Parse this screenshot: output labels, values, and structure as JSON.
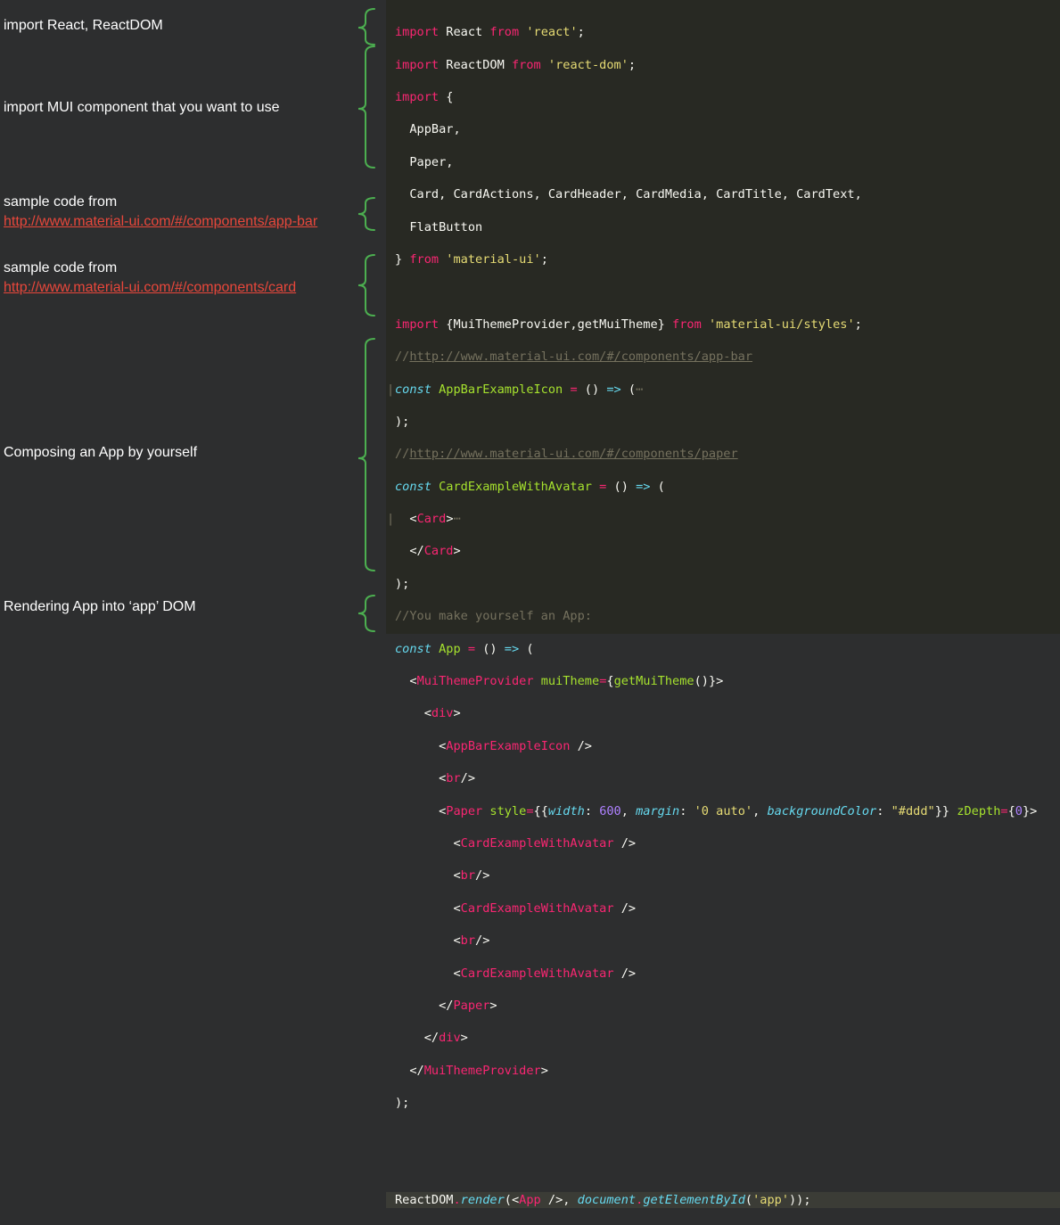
{
  "annotations": [
    {
      "id": "import-react",
      "text": "import React, ReactDOM",
      "link": ""
    },
    {
      "id": "import-mui",
      "text": "import MUI component that you want to use",
      "link": ""
    },
    {
      "id": "sample-appbar",
      "text": "sample code from",
      "link": "http://www.material-ui.com/#/components/app-bar"
    },
    {
      "id": "sample-card",
      "text": "sample code from",
      "link": "http://www.material-ui.com/#/components/card"
    },
    {
      "id": "compose-app",
      "text": "Composing an App by yourself",
      "link": ""
    },
    {
      "id": "render-app",
      "text": "Rendering App into ‘app’ DOM",
      "link": ""
    }
  ],
  "code": {
    "line1": [
      "import",
      " React ",
      "from",
      " 'react'",
      ";"
    ],
    "line2": [
      "import",
      " ReactDOM ",
      "from",
      " 'react-dom'",
      ";"
    ],
    "line3": [
      "import",
      " {"
    ],
    "line4": "  AppBar,",
    "line5": "  Paper,",
    "line6": "  Card, CardActions, CardHeader, CardMedia, CardTitle, CardText,",
    "line7": "  FlatButton",
    "line8": [
      "} ",
      "from",
      " 'material-ui'",
      ";"
    ],
    "line10": [
      "import",
      " {MuiThemeProvider,getMuiTheme} ",
      "from",
      " 'material-ui/styles'",
      ";"
    ],
    "line11": [
      "//",
      "http://www.material-ui.com/#/components/app-bar"
    ],
    "line12": [
      "const",
      " ",
      "AppBarExampleIcon",
      " ",
      "=",
      " () ",
      "=>",
      " (",
      "⋯"
    ],
    "line13": ");",
    "line14": [
      "//",
      "http://www.material-ui.com/#/components/paper"
    ],
    "line15": [
      "const",
      " ",
      "CardExampleWithAvatar",
      " ",
      "=",
      " () ",
      "=>",
      " ("
    ],
    "line16": [
      "  <",
      "Card",
      ">",
      "⋯"
    ],
    "line17": [
      "  </",
      "Card",
      ">"
    ],
    "line18": ");",
    "line19": "//You make yourself an App:",
    "line20": [
      "const",
      " ",
      "App",
      " ",
      "=",
      " () ",
      "=>",
      " ("
    ],
    "line21": [
      "  <",
      "MuiThemeProvider",
      " ",
      "muiTheme",
      "=",
      "{",
      "getMuiTheme",
      "()}>"
    ],
    "line22": [
      "    <",
      "div",
      ">"
    ],
    "line23": [
      "      <",
      "AppBarExampleIcon",
      " />"
    ],
    "line24": [
      "      <",
      "br",
      "/>"
    ],
    "line25": [
      "      <",
      "Paper",
      " ",
      "style",
      "=",
      "{{",
      "width",
      ": ",
      "600",
      ", ",
      "margin",
      ": ",
      "'0 auto'",
      ", ",
      "backgroundColor",
      ": ",
      "\"#ddd\"",
      "}} ",
      "zDepth",
      "=",
      "{",
      "0",
      "}>"
    ],
    "line26": [
      "        <",
      "CardExampleWithAvatar",
      " />"
    ],
    "line27": [
      "        <",
      "br",
      "/>"
    ],
    "line28": [
      "        <",
      "CardExampleWithAvatar",
      " />"
    ],
    "line29": [
      "        <",
      "br",
      "/>"
    ],
    "line30": [
      "        <",
      "CardExampleWithAvatar",
      " />"
    ],
    "line31": [
      "      </",
      "Paper",
      ">"
    ],
    "line32": [
      "    </",
      "div",
      ">"
    ],
    "line33": [
      "  </",
      "MuiThemeProvider",
      ">"
    ],
    "line34": ");",
    "line37": [
      "ReactDOM",
      ".",
      "render",
      "(<",
      "App",
      " />, ",
      "document",
      ".",
      "getElementById",
      "(",
      "'app'",
      "));"
    ]
  }
}
